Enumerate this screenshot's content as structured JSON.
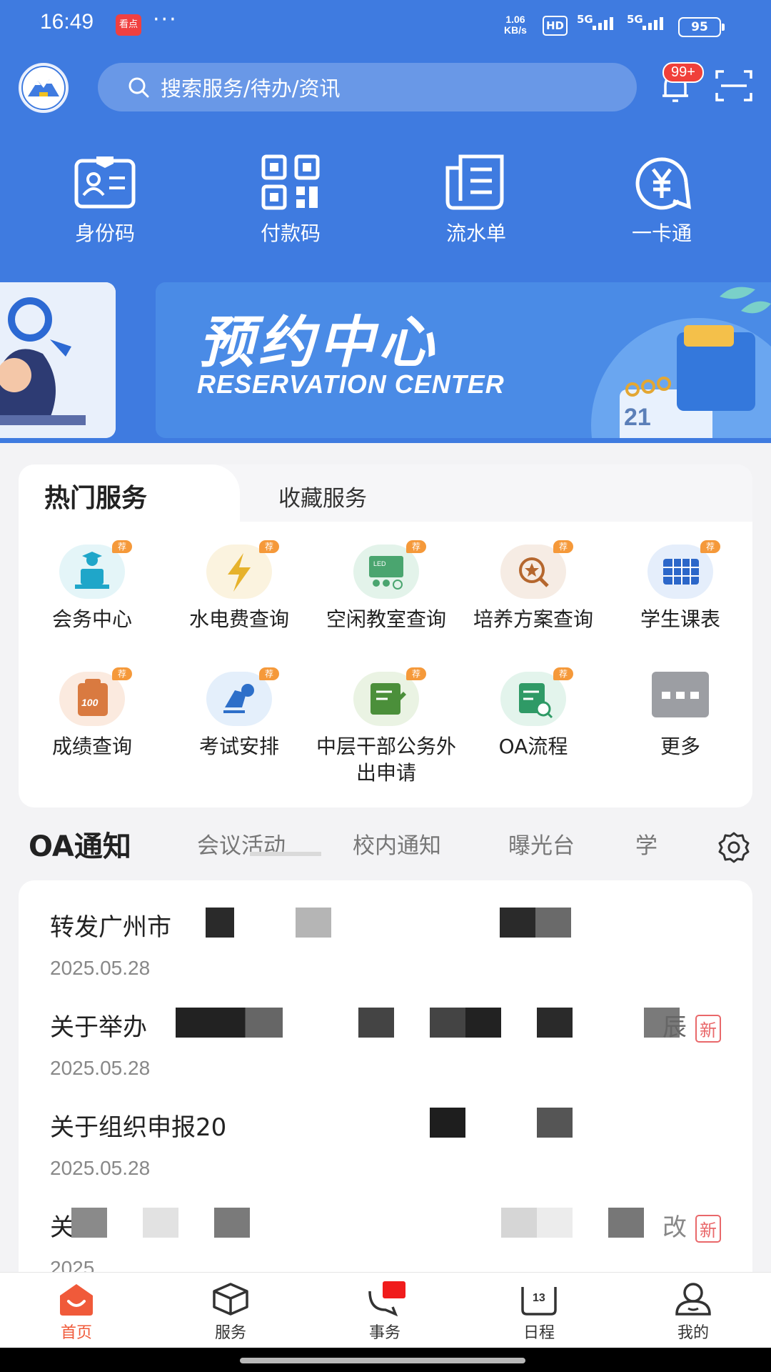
{
  "status": {
    "time": "16:49",
    "notif_label": "看点",
    "dots": "···",
    "speed_top": "1.06",
    "speed_bot": "KB/s",
    "hd": "HD",
    "sig": "5G",
    "battery": "95"
  },
  "header": {
    "search_placeholder": "搜索服务/待办/资讯",
    "badge": "99+"
  },
  "quick": [
    {
      "label": "身份码",
      "icon": "id-card-icon"
    },
    {
      "label": "付款码",
      "icon": "qr-code-icon"
    },
    {
      "label": "流水单",
      "icon": "statement-icon"
    },
    {
      "label": "一卡通",
      "icon": "yuan-card-icon"
    }
  ],
  "banner": {
    "title": "预约中心",
    "subtitle": "RESERVATION CENTER",
    "calendar": "21"
  },
  "services_tabs": {
    "active": "热门服务",
    "second": "收藏服务"
  },
  "rec": "荐",
  "services": [
    {
      "label": "会务中心",
      "icon": "meeting-icon",
      "color": "#e4f5f8"
    },
    {
      "label": "水电费查询",
      "icon": "lightning-icon",
      "color": "#fbf3df"
    },
    {
      "label": "空闲教室查询",
      "icon": "classroom-icon",
      "color": "#e3f3ea"
    },
    {
      "label": "培养方案查询",
      "icon": "plan-search-icon",
      "color": "#f6ece4"
    },
    {
      "label": "学生课表",
      "icon": "timetable-icon",
      "color": "#e5eefb"
    },
    {
      "label": "成绩查询",
      "icon": "score-icon",
      "color": "#fbeadf"
    },
    {
      "label": "考试安排",
      "icon": "exam-icon",
      "color": "#e4effb"
    },
    {
      "label": "中层干部公务外出申请",
      "icon": "application-icon",
      "color": "#eaf3e3"
    },
    {
      "label": "OA流程",
      "icon": "oa-flow-icon",
      "color": "#e3f4ec"
    },
    {
      "label": "更多",
      "icon": "more-icon",
      "color": "#ffffff"
    }
  ],
  "oa": {
    "title": "OA通知",
    "tabs": [
      "会议活动",
      "校内通知",
      "曝光台",
      "学"
    ]
  },
  "items": [
    {
      "title": "转发广州市",
      "date": "2025.05.28",
      "tail": "",
      "new": ""
    },
    {
      "title": "关于举办",
      "date": "2025.05.28",
      "tail": "辰",
      "new": "新"
    },
    {
      "title": "关于组织申报20",
      "date": "2025.05.28",
      "tail": "",
      "new": ""
    },
    {
      "title": "关于",
      "date": "2025",
      "tail": "改",
      "new": "新"
    }
  ],
  "nav": [
    {
      "label": "首页",
      "icon": "home-icon"
    },
    {
      "label": "服务",
      "icon": "box-icon"
    },
    {
      "label": "事务",
      "icon": "chat-icon"
    },
    {
      "label": "日程",
      "icon": "calendar-icon"
    },
    {
      "label": "我的",
      "icon": "user-icon"
    }
  ],
  "colors": {
    "primary": "#3f7be0",
    "accent": "#f05a3a",
    "rec": "#f5993a"
  }
}
